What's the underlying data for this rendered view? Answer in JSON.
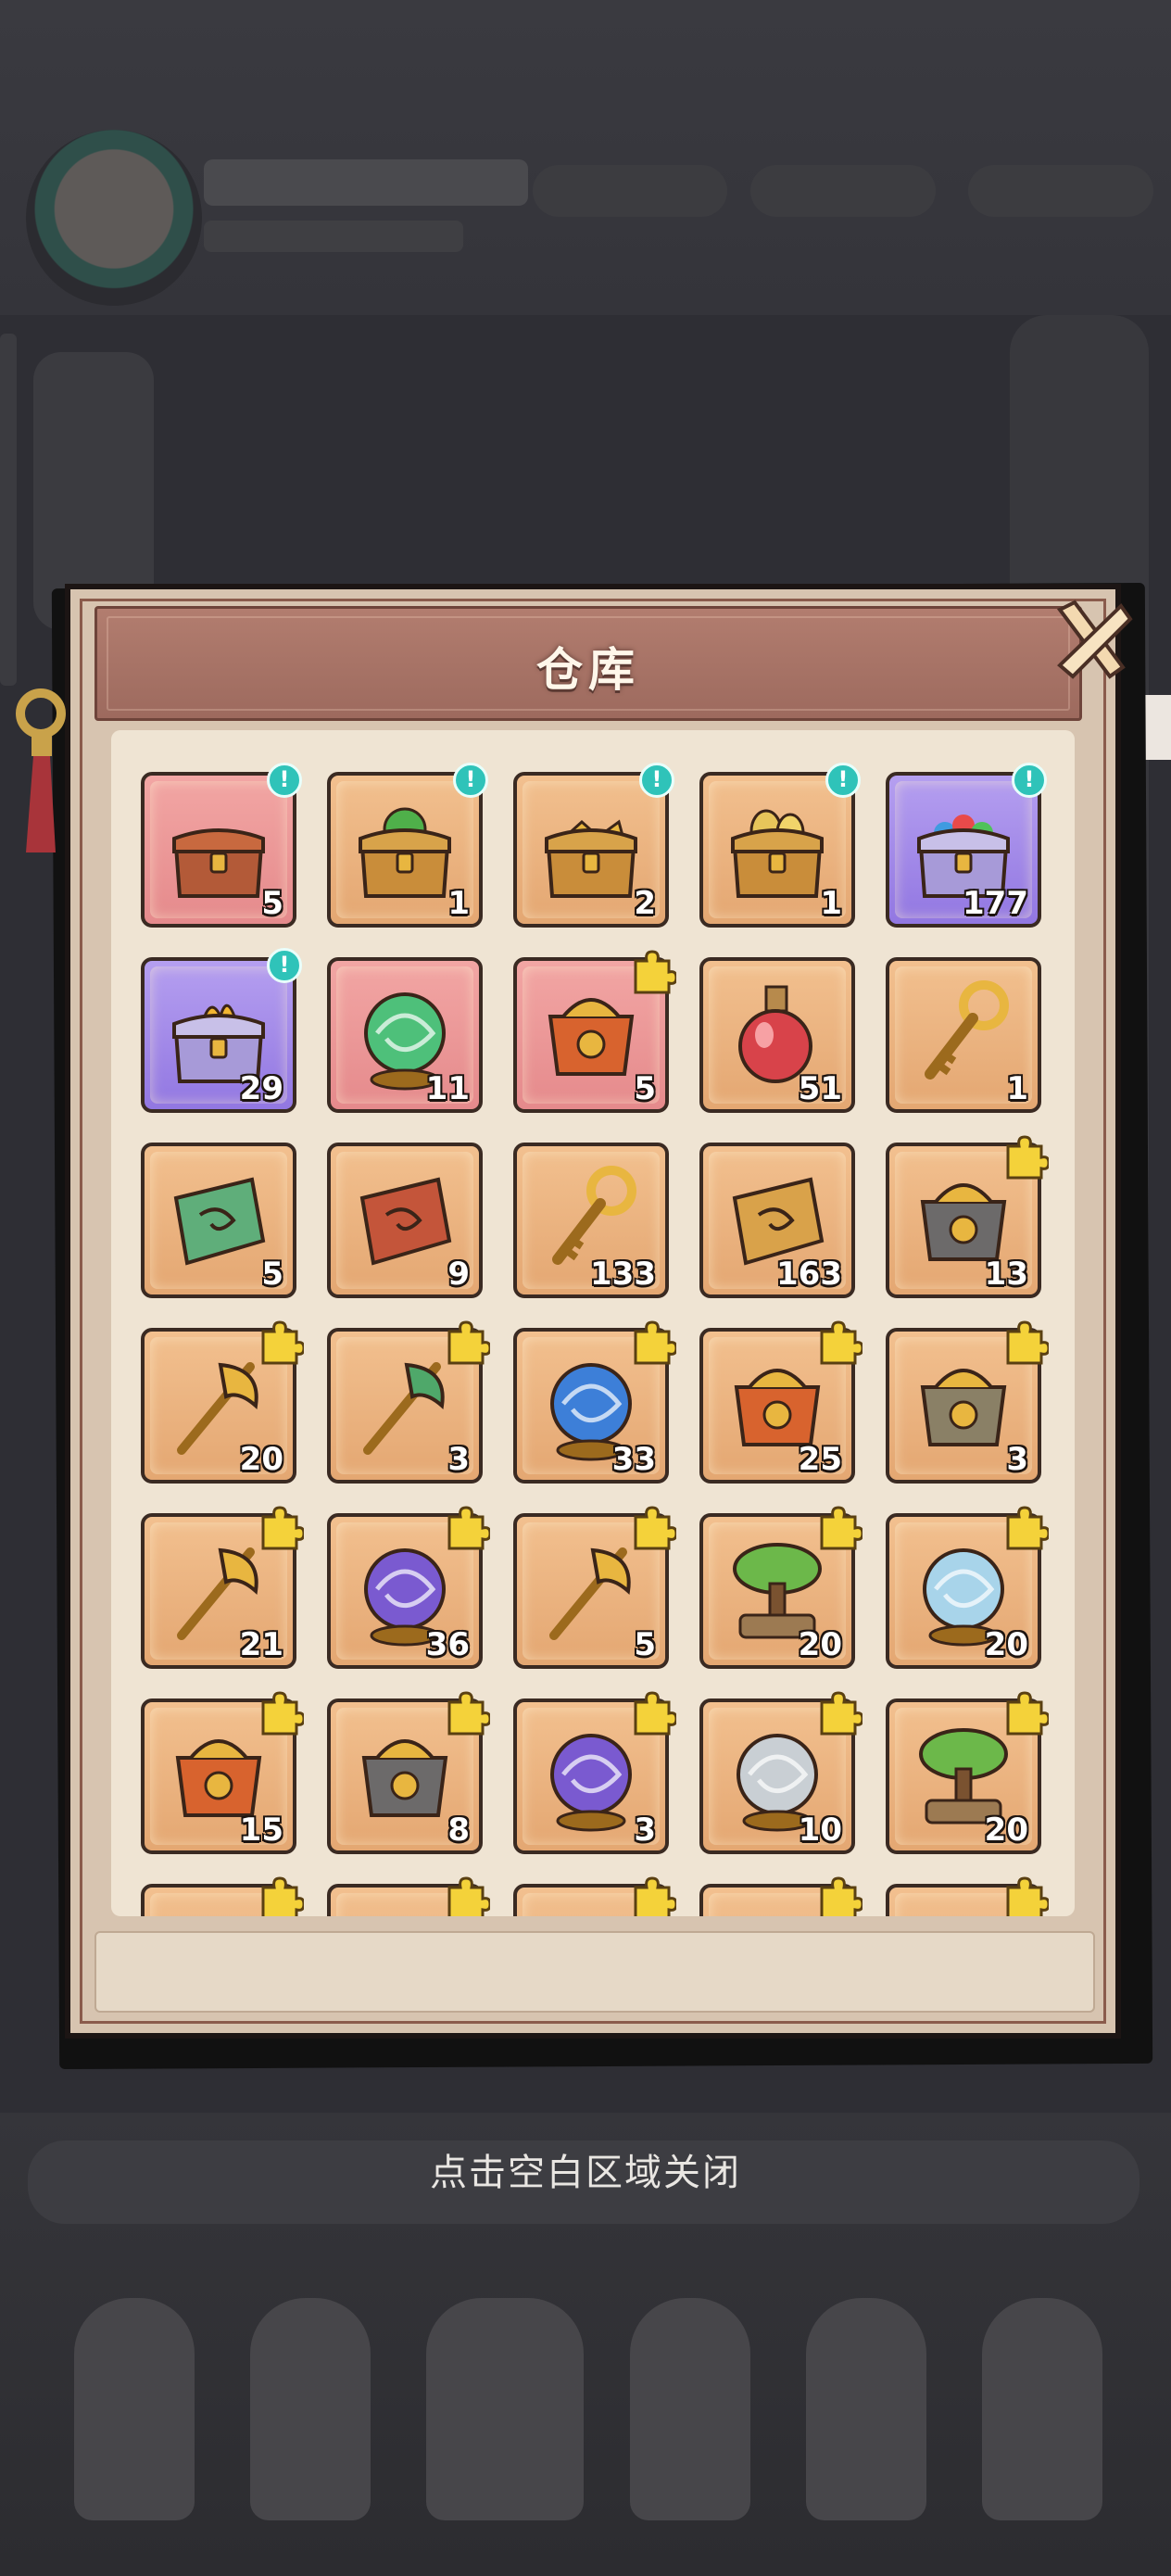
{
  "modal": {
    "title": "仓库",
    "close_icon": "close-x-icon"
  },
  "hint_text": "点击空白区域关闭",
  "accent_colors": {
    "tile_orange": "#e9b07c",
    "tile_pink": "#ec9a9a",
    "tile_purple": "#a48ae8",
    "badge_new": "#2fc3b9",
    "badge_piece": "#f4d23a",
    "modal_frame": "#a87365"
  },
  "items": [
    {
      "name": "heart-chest-icon",
      "count": "5",
      "rarity": "pink",
      "badge": "new"
    },
    {
      "name": "green-gem-gold-chest-icon",
      "count": "1",
      "rarity": "orange",
      "badge": "new"
    },
    {
      "name": "gold-puzzle-chest-icon",
      "count": "2",
      "rarity": "orange",
      "badge": "new"
    },
    {
      "name": "gold-egg-chest-icon",
      "count": "1",
      "rarity": "orange",
      "badge": "new"
    },
    {
      "name": "gem-pile-chest-icon",
      "count": "177",
      "rarity": "purple",
      "badge": "new"
    },
    {
      "name": "flame-purple-chest-icon",
      "count": "29",
      "rarity": "purple",
      "badge": "new"
    },
    {
      "name": "green-vortex-orb-icon",
      "count": "11",
      "rarity": "pink",
      "badge": "none"
    },
    {
      "name": "flame-crest-fragment-icon",
      "count": "5",
      "rarity": "pink",
      "badge": "piece"
    },
    {
      "name": "red-potion-icon",
      "count": "51",
      "rarity": "orange",
      "badge": "none"
    },
    {
      "name": "gold-swirl-key-icon",
      "count": "1",
      "rarity": "orange",
      "badge": "none"
    },
    {
      "name": "jade-spoon-plate-icon",
      "count": "5",
      "rarity": "orange",
      "badge": "none"
    },
    {
      "name": "red-scroll-icon",
      "count": "9",
      "rarity": "orange",
      "badge": "none"
    },
    {
      "name": "bronze-key-icon",
      "count": "133",
      "rarity": "orange",
      "badge": "none"
    },
    {
      "name": "gold-talisman-icon",
      "count": "163",
      "rarity": "orange",
      "badge": "none"
    },
    {
      "name": "pagoda-fragment-icon",
      "count": "13",
      "rarity": "orange",
      "badge": "piece"
    },
    {
      "name": "golden-axe-fragment-icon",
      "count": "20",
      "rarity": "orange",
      "badge": "piece"
    },
    {
      "name": "jade-scepter-fragment-icon",
      "count": "3",
      "rarity": "orange",
      "badge": "piece"
    },
    {
      "name": "blue-orb-fragment-icon",
      "count": "33",
      "rarity": "orange",
      "badge": "piece"
    },
    {
      "name": "fire-wheel-fragment-icon",
      "count": "25",
      "rarity": "orange",
      "badge": "piece"
    },
    {
      "name": "bronze-cauldron-fragment-icon",
      "count": "3",
      "rarity": "orange",
      "badge": "piece"
    },
    {
      "name": "lightning-sword-fragment-icon",
      "count": "21",
      "rarity": "orange",
      "badge": "piece"
    },
    {
      "name": "purple-ring-fragment-icon",
      "count": "36",
      "rarity": "orange",
      "badge": "piece"
    },
    {
      "name": "crossed-blades-fragment-icon",
      "count": "5",
      "rarity": "orange",
      "badge": "piece"
    },
    {
      "name": "bonsai-tree-fragment-icon",
      "count": "20",
      "rarity": "orange",
      "badge": "piece"
    },
    {
      "name": "cloud-mirror-fragment-icon",
      "count": "20",
      "rarity": "orange",
      "badge": "piece"
    },
    {
      "name": "flame-brazier-fragment-icon",
      "count": "15",
      "rarity": "orange",
      "badge": "piece"
    },
    {
      "name": "stone-shrine-fragment-icon",
      "count": "8",
      "rarity": "orange",
      "badge": "piece"
    },
    {
      "name": "purple-storm-fragment-icon",
      "count": "3",
      "rarity": "orange",
      "badge": "piece"
    },
    {
      "name": "silver-mirror-fragment-icon",
      "count": "10",
      "rarity": "orange",
      "badge": "piece"
    },
    {
      "name": "fruit-tree-fragment-icon",
      "count": "20",
      "rarity": "orange",
      "badge": "piece"
    },
    {
      "name": "jade-fan-fragment-icon",
      "count": "",
      "rarity": "orange",
      "badge": "piece"
    },
    {
      "name": "dragon-fragment-icon",
      "count": "",
      "rarity": "orange",
      "badge": "piece"
    },
    {
      "name": "dragon-fragment-icon",
      "count": "",
      "rarity": "orange",
      "badge": "piece"
    },
    {
      "name": "dragon-fragment-icon",
      "count": "",
      "rarity": "orange",
      "badge": "piece"
    },
    {
      "name": "dragon-fragment-icon",
      "count": "",
      "rarity": "orange",
      "badge": "piece"
    }
  ]
}
